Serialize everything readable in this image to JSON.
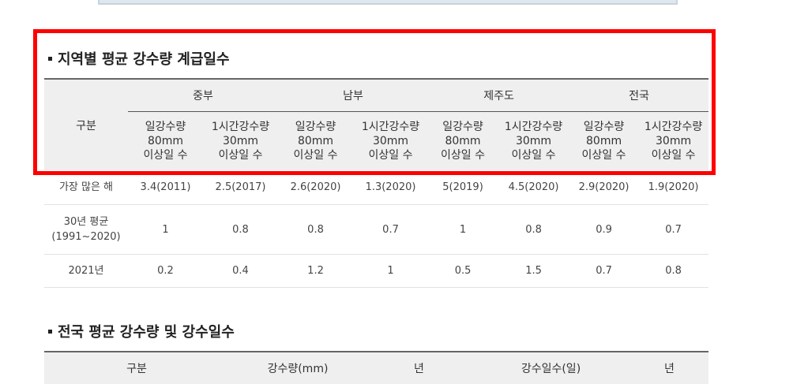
{
  "section1": {
    "title": "지역별 평균 강수량 계급일수",
    "header": {
      "category": "구분",
      "regions": [
        "중부",
        "남부",
        "제주도",
        "전국"
      ],
      "sub1": [
        "일강수량",
        "80mm",
        "이상일 수"
      ],
      "sub2": [
        "1시간강수량",
        "30mm",
        "이상일 수"
      ]
    },
    "rows": [
      {
        "label": [
          "가장 많은 해"
        ],
        "values": [
          "3.4(2011)",
          "2.5(2017)",
          "2.6(2020)",
          "1.3(2020)",
          "5(2019)",
          "4.5(2020)",
          "2.9(2020)",
          "1.9(2020)"
        ]
      },
      {
        "label": [
          "30년 평균",
          "(1991~2020)"
        ],
        "values": [
          "1",
          "0.8",
          "0.8",
          "0.7",
          "1",
          "0.8",
          "0.9",
          "0.7"
        ]
      },
      {
        "label": [
          "2021년"
        ],
        "values": [
          "0.2",
          "0.4",
          "1.2",
          "1",
          "0.5",
          "1.5",
          "0.7",
          "0.8"
        ]
      }
    ]
  },
  "section2": {
    "title": "전국 평균 강수량 및 강수일수",
    "header": [
      "구분",
      "강수량(mm)",
      "년",
      "강수일수(일)",
      "년"
    ]
  },
  "colors": {
    "highlight": "#ff0000",
    "header_bg": "#efefef"
  }
}
